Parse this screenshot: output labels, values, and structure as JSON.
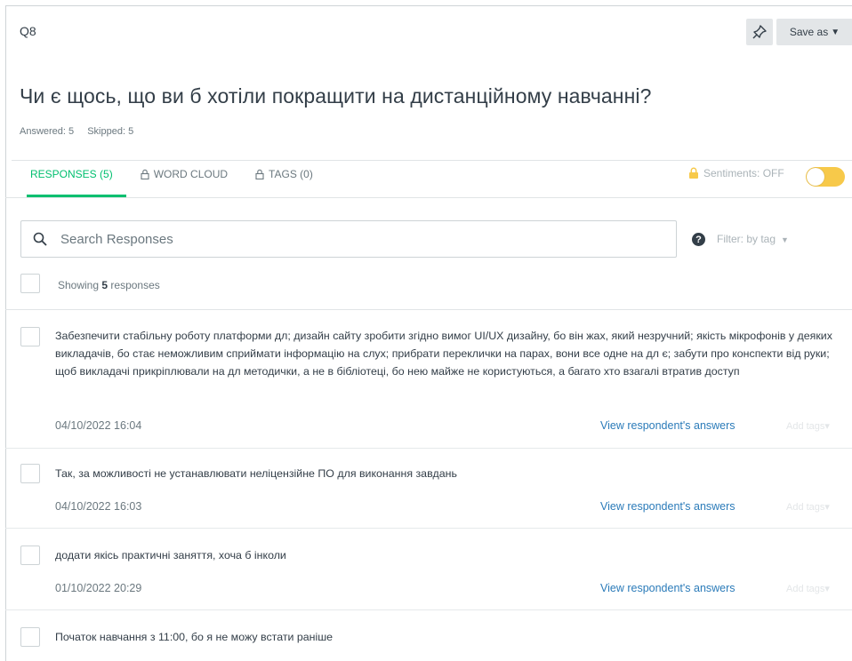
{
  "header": {
    "question_number": "Q8",
    "save_as_label": "Save as",
    "pin_icon": "pin-icon"
  },
  "question": {
    "title": "Чи є щось, що ви б хотіли покращити на дистанційному навчанні?",
    "answered": "Answered: 5",
    "skipped": "Skipped: 5"
  },
  "tabs": [
    {
      "label": "RESPONSES (5)",
      "active": true
    },
    {
      "label": "WORD CLOUD",
      "active": false,
      "icon": "lock-icon"
    },
    {
      "label": "TAGS (0)",
      "active": false,
      "icon": "lock-icon"
    }
  ],
  "sentiments": {
    "label": "Sentiments: OFF",
    "toggle_on": false,
    "accent_color": "#f7c94a"
  },
  "search": {
    "placeholder": "Search Responses",
    "value": ""
  },
  "filter": {
    "label": "Filter: by tag"
  },
  "showing": {
    "prefix": "Showing",
    "count": "5",
    "suffix": "responses"
  },
  "responses": [
    {
      "text": "Забезпечити стабільну роботу платформи дл; дизайн сайту зробити згідно вимог UI/UX дизайну, бо він жах, який незручний; якість мікрофонів у деяких викладачів, бо стає неможливим сприймати інформацію на слух; прибрати переклички на парах, вони все одне на дл є; забути про конспекти від руки; щоб викладачі прикріплювали на дл методички, а не в бібліотеці, бо нею майже не користуються, а багато хто взагалі втратив доступ",
      "date": "04/10/2022 16:04",
      "view_label": "View respondent's answers",
      "tags_label": "Add tags"
    },
    {
      "text": "Так, за можливості не устанавлювати неліцензійне ПО для виконання завдань",
      "date": "04/10/2022 16:03",
      "view_label": "View respondent's answers",
      "tags_label": "Add tags"
    },
    {
      "text": "додати якісь практичні заняття, хоча б інколи",
      "date": "01/10/2022 20:29",
      "view_label": "View respondent's answers",
      "tags_label": "Add tags"
    },
    {
      "text": "Початок навчання з 11:00, бо я не можу встати раніше"
    }
  ],
  "colors": {
    "accent_green": "#00bf6f",
    "link_blue": "#2b7bb9",
    "text_dark": "#333e48",
    "text_muted": "#6b787f"
  }
}
